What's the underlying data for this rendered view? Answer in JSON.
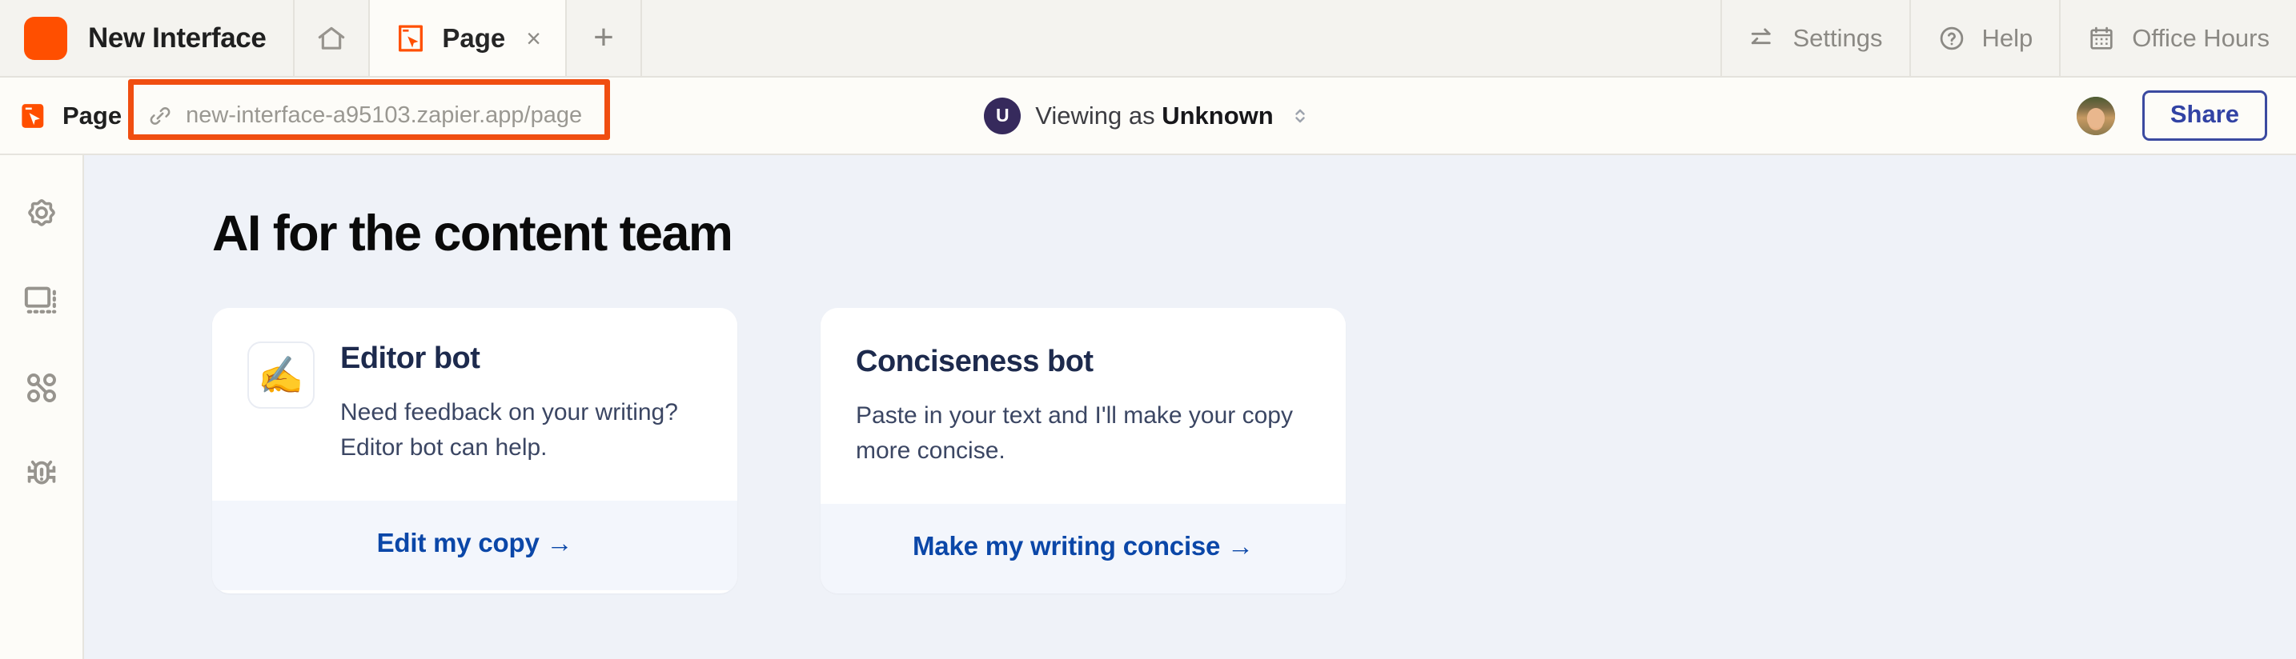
{
  "tabbar": {
    "brand_title": "New Interface",
    "home_icon": "home-icon",
    "tabs": [
      {
        "label": "Page",
        "icon": "page-cursor-icon",
        "close_label": "×",
        "active": true
      }
    ],
    "new_tab_label": "+",
    "actions": [
      {
        "label": "Settings",
        "icon": "sliders-icon"
      },
      {
        "label": "Help",
        "icon": "question-circle-icon"
      },
      {
        "label": "Office Hours",
        "icon": "calendar-icon"
      }
    ]
  },
  "urlbar": {
    "left_label": "Page",
    "left_icon": "page-cursor-icon",
    "link_icon": "link-chain-icon",
    "url": "new-interface-a95103.zapier.app/page",
    "annotation_color": "#f04e11",
    "viewing": {
      "avatar_initial": "U",
      "avatar_color": "#362a5c",
      "prefix": "Viewing as",
      "name": "Unknown",
      "selector_icon": "chevron-updown-icon"
    },
    "user_avatar_name": "user-avatar",
    "share_label": "Share",
    "share_color": "#3243a4"
  },
  "sidebar": {
    "items": [
      {
        "name": "sidebar-item-settings",
        "icon": "gear-icon"
      },
      {
        "name": "sidebar-item-layout",
        "icon": "layout-frame-icon"
      },
      {
        "name": "sidebar-item-components",
        "icon": "components-nodes-icon"
      },
      {
        "name": "sidebar-item-debug",
        "icon": "bug-icon"
      }
    ]
  },
  "main": {
    "heading": "AI for the content team",
    "cards": [
      {
        "emoji": "✍️",
        "emoji_name": "writing-hand-emoji",
        "title": "Editor bot",
        "description": "Need feedback on your writing? Editor bot can help.",
        "cta": "Edit my copy →"
      },
      {
        "emoji": "",
        "emoji_name": "",
        "title": "Conciseness bot",
        "description": "Paste in your text and I'll make your copy more concise.",
        "cta": "Make my writing concise →"
      }
    ]
  },
  "colors": {
    "brand_orange": "#ff4f00",
    "annotation_orange": "#f04e11",
    "link_blue": "#0b47a8",
    "share_indigo": "#3243a4",
    "page_bg": "#eff2f8",
    "chrome_bg": "#f4f3ef",
    "panel_bg": "#fdfcf8"
  }
}
